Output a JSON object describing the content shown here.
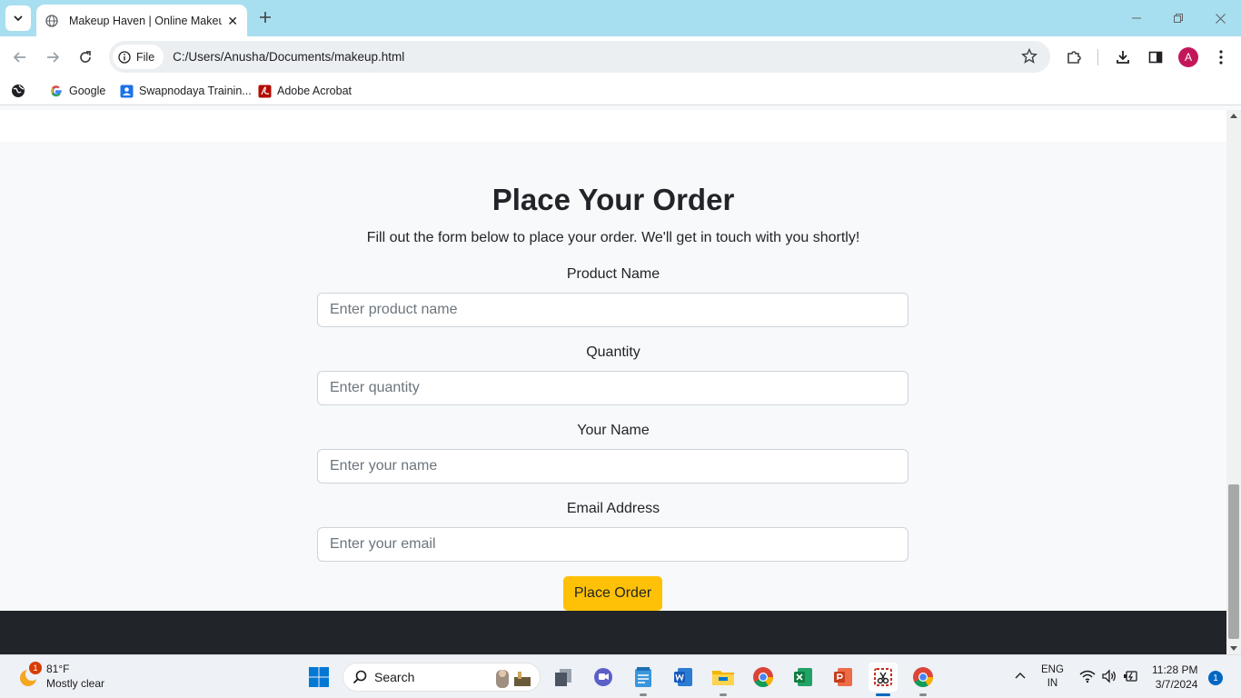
{
  "browser": {
    "tab": {
      "title": "Makeup Haven | Online Makeup Store"
    },
    "address_bar": {
      "scheme_label": "File",
      "url": "C:/Users/Anusha/Documents/makeup.html"
    },
    "profile_initial": "A",
    "bookmarks": [
      {
        "label": "Google",
        "icon": "google-icon"
      },
      {
        "label": "Swapnodaya Trainin...",
        "icon": "profile-card-icon"
      },
      {
        "label": "Adobe Acrobat",
        "icon": "acrobat-icon"
      }
    ]
  },
  "page": {
    "title": "Place Your Order",
    "subtitle": "Fill out the form below to place your order. We'll get in touch with you shortly!",
    "fields": [
      {
        "label": "Product Name",
        "placeholder": "Enter product name",
        "value": ""
      },
      {
        "label": "Quantity",
        "placeholder": "Enter quantity",
        "value": ""
      },
      {
        "label": "Your Name",
        "placeholder": "Enter your name",
        "value": ""
      },
      {
        "label": "Email Address",
        "placeholder": "Enter your email",
        "value": ""
      }
    ],
    "submit_label": "Place Order",
    "colors": {
      "accent": "#ffc107",
      "footer": "#212529",
      "background": "#f8f9fa"
    }
  },
  "taskbar": {
    "weather": {
      "temp": "81°F",
      "condition": "Mostly clear",
      "badge": "1"
    },
    "search_label": "Search",
    "language": {
      "line1": "ENG",
      "line2": "IN"
    },
    "clock": {
      "time": "11:28 PM",
      "date": "3/7/2024"
    },
    "notification_count": "1"
  }
}
